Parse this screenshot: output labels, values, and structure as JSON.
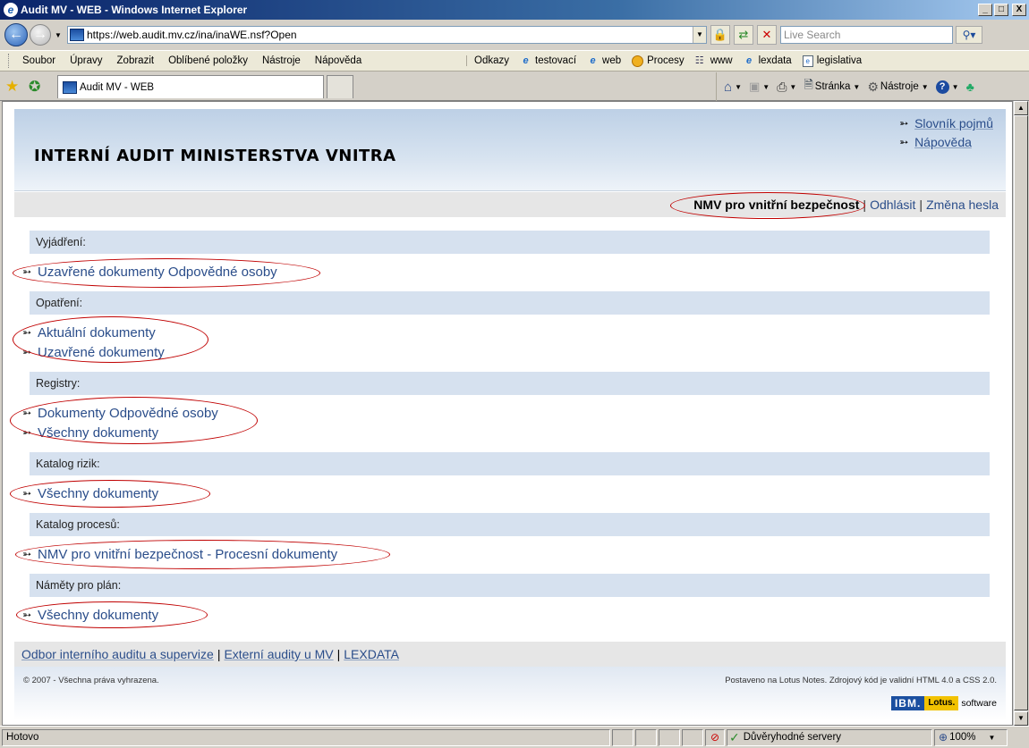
{
  "window": {
    "title": "Audit MV - WEB - Windows Internet Explorer",
    "minimize": "_",
    "maximize": "□",
    "close": "X"
  },
  "address": {
    "url": "https://web.audit.mv.cz/ina/inaWE.nsf?Open",
    "search_placeholder": "Live Search"
  },
  "menu": {
    "items": [
      "Soubor",
      "Úpravy",
      "Zobrazit",
      "Oblíbené položky",
      "Nástroje",
      "Nápověda"
    ]
  },
  "links_bar": {
    "label": "Odkazy",
    "items": [
      "testovací",
      "web",
      "Procesy",
      "www",
      "lexdata",
      "legislativa"
    ]
  },
  "tab": {
    "title": "Audit MV - WEB"
  },
  "commands": {
    "page": "Stránka",
    "tools": "Nástroje"
  },
  "page": {
    "title": "INTERNÍ AUDIT MINISTERSTVA VNITRA",
    "header_links": [
      "Slovník pojmů",
      "Nápověda"
    ],
    "user": "NMV pro vnitřní bezpečnost",
    "logout": "Odhlásit",
    "change_password": "Změna hesla",
    "sections": [
      {
        "title": "Vyjádření:",
        "links": [
          "Uzavřené dokumenty Odpovědné osoby"
        ]
      },
      {
        "title": "Opatření:",
        "links": [
          "Aktuální dokumenty",
          "Uzavřené dokumenty"
        ]
      },
      {
        "title": "Registry:",
        "links": [
          "Dokumenty Odpovědné osoby",
          "Všechny dokumenty"
        ]
      },
      {
        "title": "Katalog rizik:",
        "links": [
          "Všechny dokumenty"
        ]
      },
      {
        "title": "Katalog procesů:",
        "links": [
          "NMV pro vnitřní bezpečnost - Procesní dokumenty"
        ]
      },
      {
        "title": "Náměty pro plán:",
        "links": [
          "Všechny dokumenty"
        ]
      }
    ],
    "footer_links": [
      "Odbor interního auditu a supervize",
      "Externí audity u MV",
      "LEXDATA"
    ],
    "copyright": "© 2007 - Všechna práva vyhrazena.",
    "powered": "Postaveno na Lotus Notes. Zdrojový kód je validní HTML 4.0 a CSS 2.0.",
    "ibm": "IBM.",
    "lotus": "Lotus.",
    "software": "software"
  },
  "status": {
    "text": "Hotovo",
    "zone": "Důvěryhodné servery",
    "zoom": "100%"
  },
  "colors": {
    "link": "#2a4d8a",
    "section_bg": "#d6e1ef",
    "annotation": "#c00000"
  }
}
